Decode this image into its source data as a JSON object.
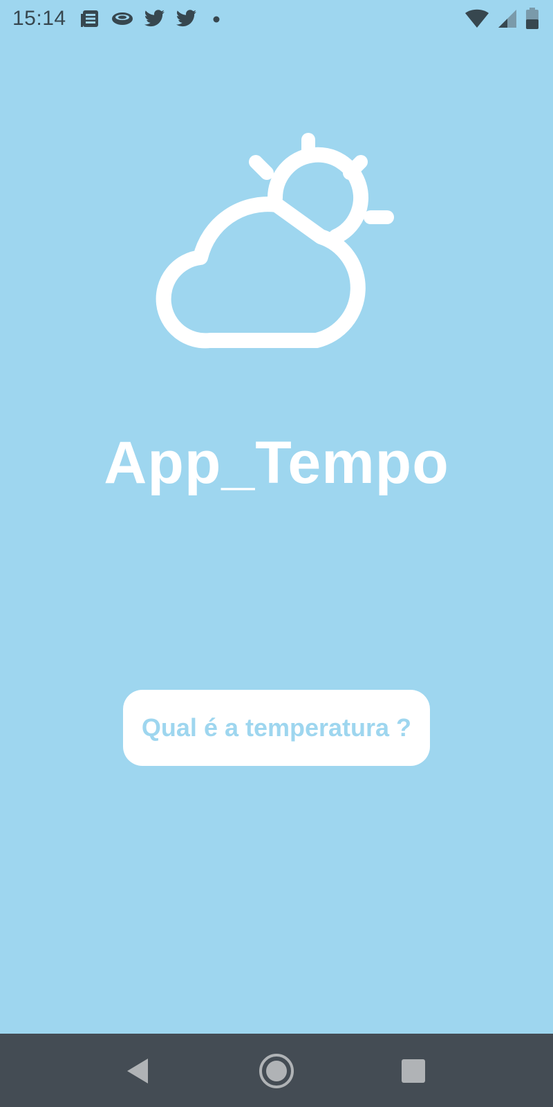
{
  "status_bar": {
    "time": "15:14",
    "left_icons": [
      "news-icon",
      "eye-icon",
      "twitter-icon",
      "twitter-icon",
      "dot-icon"
    ],
    "right_icons": [
      "wifi-icon",
      "cellular-signal-icon",
      "battery-icon"
    ]
  },
  "app": {
    "logo_icon": "partly-cloudy-icon",
    "title": "App_Tempo",
    "button_label": "Qual é a temperatura ?"
  },
  "nav_bar": {
    "icons": [
      "back-icon",
      "home-icon",
      "recents-icon"
    ]
  },
  "colors": {
    "background": "#9ED6EF",
    "title": "#FFFFFF",
    "button_background": "#FFFFFF",
    "button_text": "#9ED6EF",
    "status_icons": "#37474F",
    "nav_bar": "#444C54",
    "nav_icons": "#B0B3B6"
  }
}
